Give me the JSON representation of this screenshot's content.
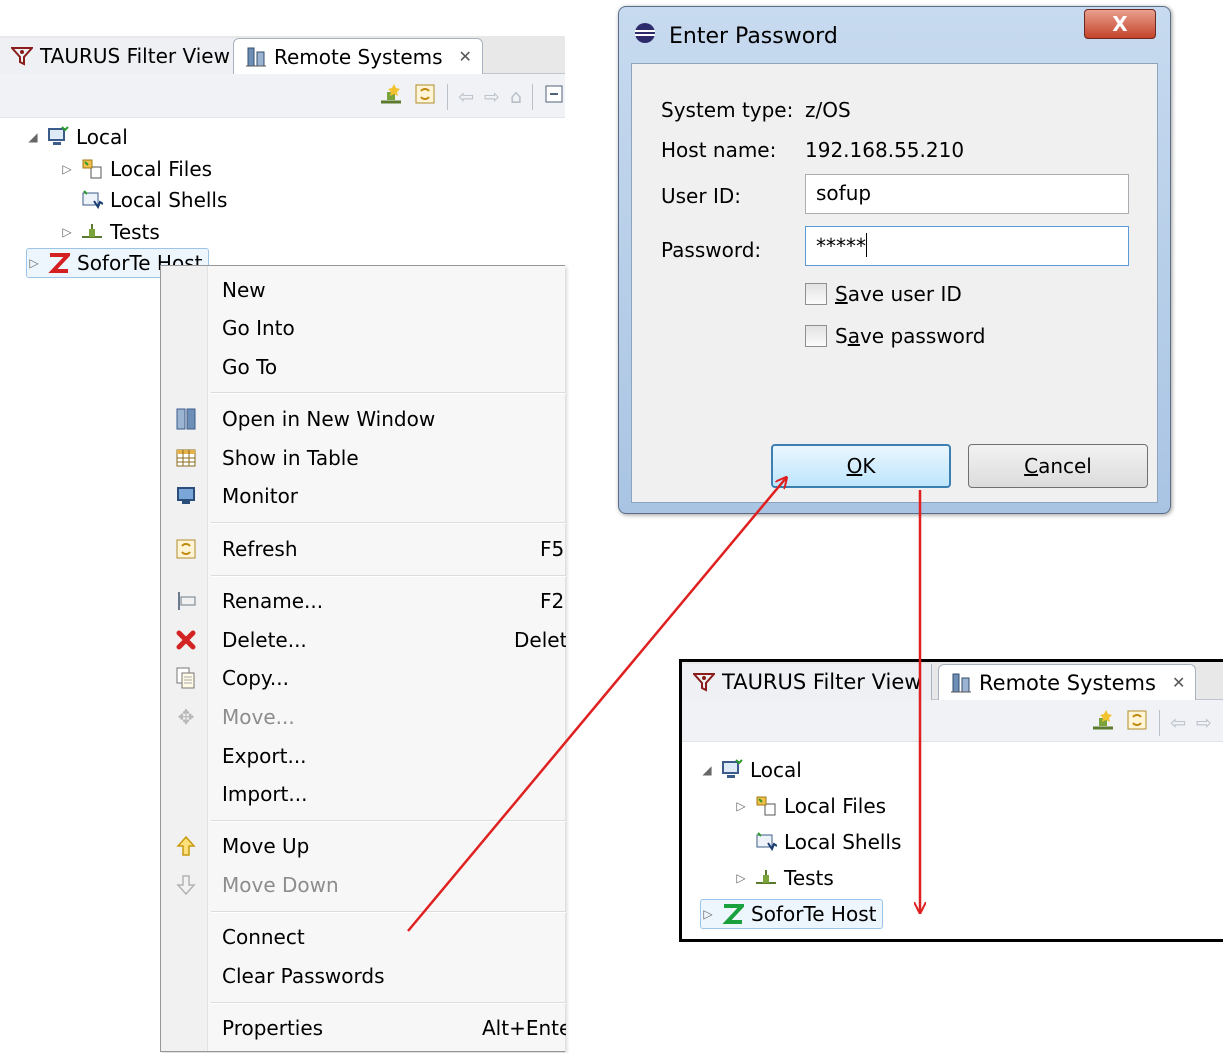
{
  "left_view": {
    "tabs": [
      {
        "label": "TAURUS Filter View",
        "icon": "taurus-filter-icon",
        "active": false
      },
      {
        "label": "Remote Systems",
        "icon": "remote-systems-icon",
        "active": true,
        "close": "✕"
      }
    ],
    "toolbar_icons": [
      "new-connection-icon",
      "refresh-icon",
      "back-icon",
      "forward-icon",
      "home-icon",
      "collapse-icon"
    ],
    "tree": [
      {
        "label": "Local",
        "icon": "local-system-icon",
        "twisty": "◢",
        "level": 0
      },
      {
        "label": "Local Files",
        "icon": "local-files-icon",
        "twisty": "▷",
        "level": 1
      },
      {
        "label": "Local Shells",
        "icon": "local-shells-icon",
        "twisty": "",
        "level": 1
      },
      {
        "label": "Tests",
        "icon": "tests-icon",
        "twisty": "▷",
        "level": 1
      },
      {
        "label": "SoforTe Host",
        "icon": "zos-host-icon",
        "twisty": "▷",
        "level": 0
      }
    ]
  },
  "context_menu": {
    "items": [
      {
        "label": "New",
        "shortcut": "",
        "icon": ""
      },
      {
        "label": "Go Into",
        "shortcut": "",
        "icon": ""
      },
      {
        "label": "Go To",
        "shortcut": "",
        "icon": ""
      },
      {
        "label": "Open in New Window",
        "shortcut": "",
        "icon": "new-window-icon"
      },
      {
        "label": "Show in Table",
        "shortcut": "",
        "icon": "table-icon"
      },
      {
        "label": "Monitor",
        "shortcut": "",
        "icon": "monitor-icon"
      },
      {
        "label": "Refresh",
        "shortcut": "F5",
        "icon": "refresh-icon"
      },
      {
        "label": "Rename...",
        "shortcut": "F2",
        "icon": "rename-icon"
      },
      {
        "label": "Delete...",
        "shortcut": "Delete",
        "icon": "delete-icon"
      },
      {
        "label": "Copy...",
        "shortcut": "",
        "icon": "copy-icon"
      },
      {
        "label": "Move...",
        "shortcut": "",
        "icon": "move-icon",
        "disabled": true
      },
      {
        "label": "Export...",
        "shortcut": "",
        "icon": ""
      },
      {
        "label": "Import...",
        "shortcut": "",
        "icon": ""
      },
      {
        "label": "Move Up",
        "shortcut": "",
        "icon": "arrow-up-icon"
      },
      {
        "label": "Move Down",
        "shortcut": "",
        "icon": "arrow-down-icon",
        "disabled": true
      },
      {
        "label": "Connect",
        "shortcut": "",
        "icon": ""
      },
      {
        "label": "Clear Passwords",
        "shortcut": "",
        "icon": ""
      },
      {
        "label": "Properties",
        "shortcut": "Alt+Enter",
        "icon": ""
      }
    ]
  },
  "dialog": {
    "title": "Enter Password",
    "close_label": "X",
    "system_type_label": "System type:",
    "system_type": "z/OS",
    "host_name_label": "Host name:",
    "host_name": "192.168.55.210",
    "user_id_label": "User ID:",
    "user_id": "sofup",
    "password_label": "Password:",
    "password": "*****",
    "save_user_id": {
      "label_first": "S",
      "label_rest": "ave user ID",
      "checked": false
    },
    "save_password": {
      "label_first": "S",
      "label_u": "a",
      "label_rest": "ve password",
      "checked": false
    },
    "ok": {
      "ul": "O",
      "rest": "K"
    },
    "cancel": {
      "ul": "C",
      "rest": "ancel"
    }
  },
  "right_view": {
    "tabs": [
      {
        "label": "TAURUS Filter View",
        "icon": "taurus-filter-icon"
      },
      {
        "label": "Remote Systems",
        "icon": "remote-systems-icon",
        "close": "✕"
      }
    ],
    "tree": [
      {
        "label": "Local",
        "twisty": "◢"
      },
      {
        "label": "Local Files",
        "twisty": "▷"
      },
      {
        "label": "Local Shells",
        "twisty": ""
      },
      {
        "label": "Tests",
        "twisty": "▷"
      },
      {
        "label": "SoforTe Host",
        "twisty": "▷"
      }
    ]
  },
  "colors": {
    "arrow": "#e02020",
    "host_left": "#d42020",
    "host_right": "#1aa03c",
    "accent_blue": "#3c7fb1"
  }
}
